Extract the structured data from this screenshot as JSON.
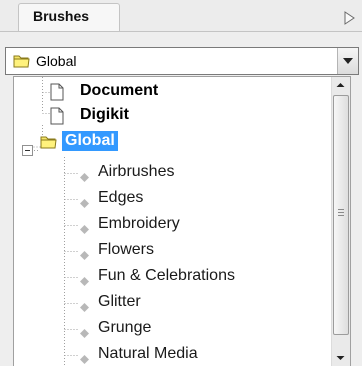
{
  "panel": {
    "tab_label": "Brushes",
    "menu_icon": "triangle-right-icon"
  },
  "selector": {
    "value": "Global",
    "icon": "yellow-folder-icon",
    "button_icon": "chevron-down-icon"
  },
  "tree": {
    "items": [
      {
        "label": "Document",
        "icon": "page-icon",
        "bold": true
      },
      {
        "label": "Digikit",
        "icon": "page-icon",
        "bold": true
      },
      {
        "label": "Global",
        "icon": "yellow-folder-icon",
        "bold": true,
        "selected": true,
        "expanded": true
      },
      {
        "label": "Airbrushes",
        "icon": "diamond-bullet-icon"
      },
      {
        "label": "Edges",
        "icon": "diamond-bullet-icon"
      },
      {
        "label": "Embroidery",
        "icon": "diamond-bullet-icon"
      },
      {
        "label": "Flowers",
        "icon": "diamond-bullet-icon"
      },
      {
        "label": "Fun & Celebrations",
        "icon": "diamond-bullet-icon"
      },
      {
        "label": "Glitter",
        "icon": "diamond-bullet-icon"
      },
      {
        "label": "Grunge",
        "icon": "diamond-bullet-icon"
      },
      {
        "label": "Natural Media",
        "icon": "diamond-bullet-icon"
      }
    ]
  },
  "scrollbar": {
    "position": 0.0
  }
}
